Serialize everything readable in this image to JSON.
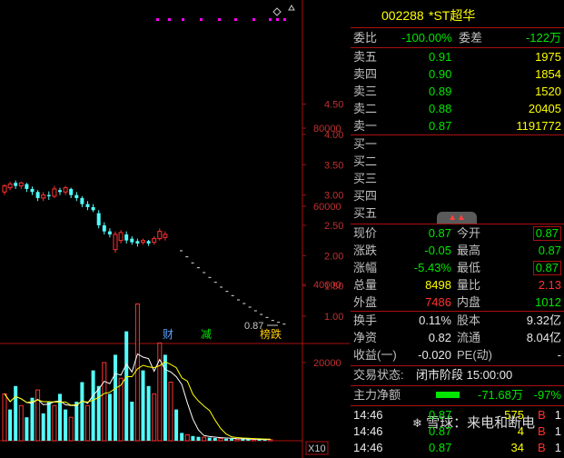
{
  "header": {
    "code": "002288",
    "name": "*ST超华"
  },
  "chart": {
    "y_ticks": [
      "4.50",
      "4.00",
      "3.50",
      "3.00",
      "2.50",
      "2.00",
      "1.50",
      "1.00"
    ],
    "vol_ticks": [
      "80000",
      "60000",
      "40000",
      "20000"
    ],
    "vol_unit": "X10",
    "last_price_label": "0.87",
    "event_tags": [
      "财",
      "减",
      "榜跌"
    ]
  },
  "quote": {
    "weibi": {
      "label": "委比",
      "value": "-100.00%",
      "label2": "委差",
      "value2": "-122万"
    },
    "asks": [
      {
        "label": "卖五",
        "price": "0.91",
        "vol": "1975"
      },
      {
        "label": "卖四",
        "price": "0.90",
        "vol": "1854"
      },
      {
        "label": "卖三",
        "price": "0.89",
        "vol": "1520"
      },
      {
        "label": "卖二",
        "price": "0.88",
        "vol": "20405"
      },
      {
        "label": "卖一",
        "price": "0.87",
        "vol": "1191772"
      }
    ],
    "bids": [
      {
        "label": "买一"
      },
      {
        "label": "买二"
      },
      {
        "label": "买三"
      },
      {
        "label": "买四"
      },
      {
        "label": "买五"
      }
    ],
    "stats": [
      {
        "l1": "现价",
        "v1": "0.87",
        "l2": "今开",
        "v2": "0.87"
      },
      {
        "l1": "涨跌",
        "v1": "-0.05",
        "l2": "最高",
        "v2": "0.87"
      },
      {
        "l1": "涨幅",
        "v1": "-5.43%",
        "l2": "最低",
        "v2": "0.87"
      },
      {
        "l1": "总量",
        "v1": "8498",
        "l2": "量比",
        "v2": "2.13"
      },
      {
        "l1": "外盘",
        "v1": "7486",
        "l2": "内盘",
        "v2": "1012"
      }
    ],
    "stats2": [
      {
        "l1": "换手",
        "v1": "0.11%",
        "l2": "股本",
        "v2": "9.32亿"
      },
      {
        "l1": "净资",
        "v1": "0.82",
        "l2": "流通",
        "v2": "8.04亿"
      },
      {
        "l1": "收益(一)",
        "v1": "-0.020",
        "l2": "PE(动)",
        "v2": "-"
      }
    ],
    "status": {
      "label": "交易状态:",
      "value": "闭市阶段 15:00:00"
    },
    "mainflow": {
      "label": "主力净额",
      "value": "-71.68万",
      "pct": "-97%"
    },
    "ticks": [
      {
        "time": "14:46",
        "price": "0.87",
        "vol": "575",
        "side": "B",
        "n": "1"
      },
      {
        "time": "14:46",
        "price": "0.87",
        "vol": "4",
        "side": "B",
        "n": "1"
      },
      {
        "time": "14:46",
        "price": "0.87",
        "vol": "34",
        "side": "B",
        "n": "1"
      }
    ],
    "watermark": "雪球：来电和断电"
  },
  "colors": {
    "up": "#ff3232",
    "down": "#54fcfc",
    "grid": "#aa1010",
    "green": "#00e600",
    "yellow": "#ffff00",
    "magenta": "#ff00ff"
  }
}
